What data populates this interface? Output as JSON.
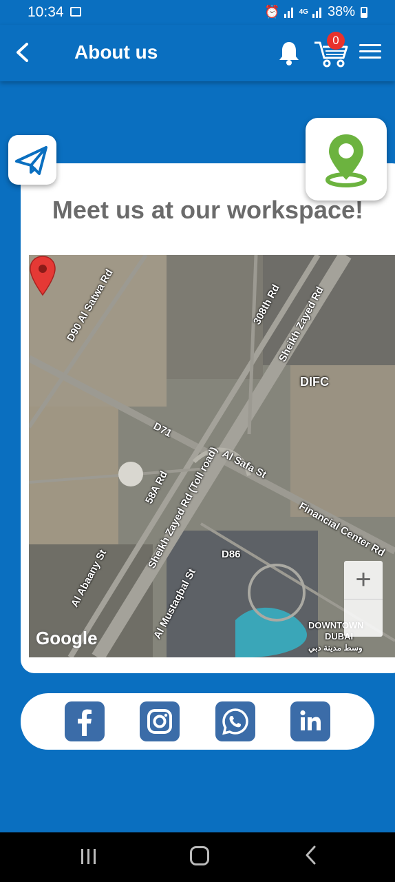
{
  "status_bar": {
    "time": "10:34",
    "network": "4G",
    "battery": "38%"
  },
  "app_bar": {
    "title": "About us",
    "cart_count": "0"
  },
  "workspace": {
    "heading": "Meet us at our workspace!"
  },
  "map": {
    "provider_logo": "Google",
    "labels": {
      "al_satwa": "D90 Al Satwa Rd",
      "road_308": "308th Rd",
      "sheikh_zayed_top": "Sheikh Zayed Rd",
      "difc": "DIFC",
      "d71": "D71",
      "al_safa": "Al Safa St",
      "rd_58a": "58A Rd",
      "sheikh_zayed_toll": "Sheikh Zayed Rd (Toll road)",
      "financial_center": "Financial Center Rd",
      "d86": "D86",
      "al_abaany": "Al Abaany St",
      "al_mustaqbal": "Al Mustaqbal St",
      "downtown": "DOWNTOWN",
      "dubai": "DUBAI",
      "downtown_ar": "وسط مدينة دبي"
    },
    "zoom_in_label": "+"
  },
  "social": {
    "icons": [
      "facebook-icon",
      "instagram-icon",
      "whatsapp-icon",
      "linkedin-icon"
    ]
  },
  "colors": {
    "primary": "#0a6fc0",
    "badge": "#e8312b",
    "heading": "#6b6b6b",
    "location_green": "#6cb33f",
    "social_blue": "#3b6ca8",
    "pin_red": "#e53935"
  }
}
